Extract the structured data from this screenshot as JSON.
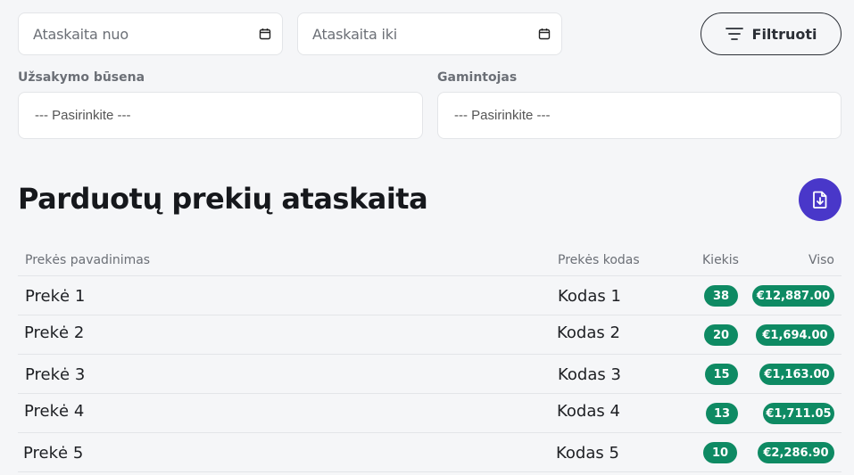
{
  "filters": {
    "date_from_placeholder": "Ataskaita nuo",
    "date_to_placeholder": "Ataskaita iki",
    "filter_button_label": "Filtruoti",
    "status_label": "Užsakymo būsena",
    "status_placeholder": "--- Pasirinkite ---",
    "manufacturer_label": "Gamintojas",
    "manufacturer_placeholder": "--- Pasirinkite ---"
  },
  "report": {
    "title": "Parduotų prekių ataskaita",
    "columns": {
      "name": "Prekės pavadinimas",
      "code": "Prekės kodas",
      "quantity": "Kiekis",
      "total": "Viso"
    },
    "rows": [
      {
        "name": "Prekė 1",
        "code": "Kodas 1",
        "quantity": "38",
        "total": "€12,887.00"
      },
      {
        "name": "Prekė 2",
        "code": "Kodas 2",
        "quantity": "20",
        "total": "€1,694.00"
      },
      {
        "name": "Prekė 3",
        "code": "Kodas 3",
        "quantity": "15",
        "total": "€1,163.00"
      },
      {
        "name": "Prekė 4",
        "code": "Kodas 4",
        "quantity": "13",
        "total": "€1,711.05"
      },
      {
        "name": "Prekė 5",
        "code": "Kodas 5",
        "quantity": "10",
        "total": "€2,286.90"
      }
    ]
  },
  "colors": {
    "accent": "#4937c9",
    "badge": "#0e8a63"
  },
  "icons": {
    "calendar": "calendar-icon",
    "filter": "filter-lines-icon",
    "export": "file-download-icon"
  }
}
